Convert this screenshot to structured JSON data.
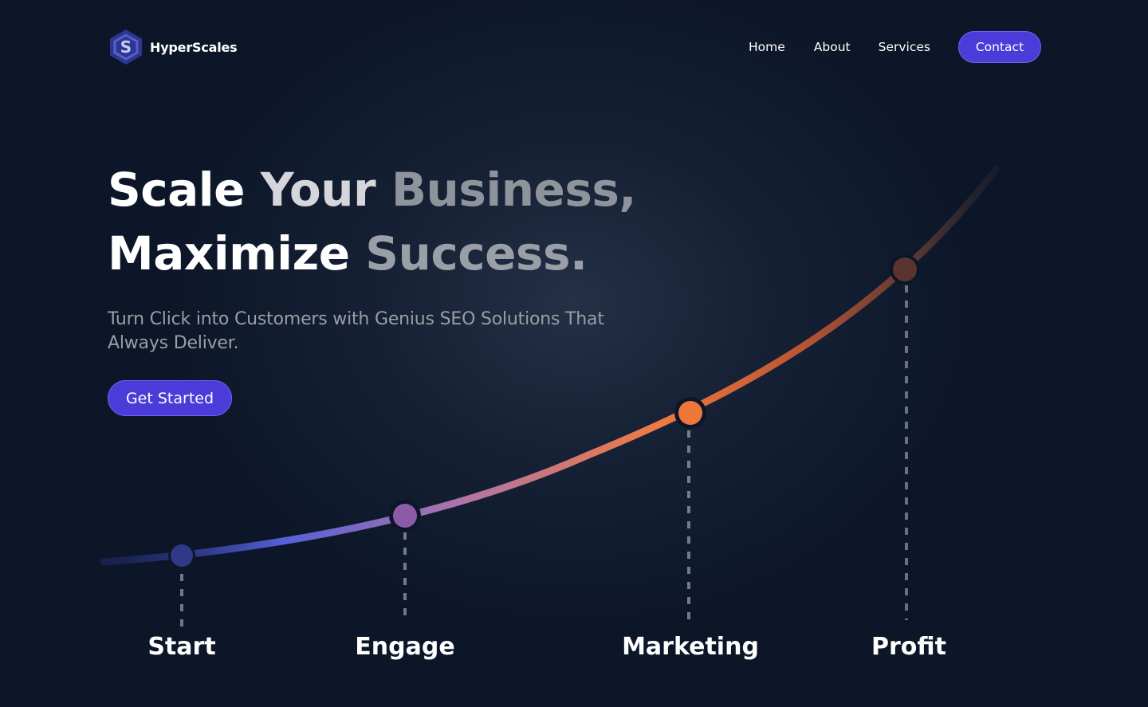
{
  "brand": {
    "name": "HyperScales",
    "logo_icon": "hex-s-logo-icon",
    "logo_letter": "S",
    "colors": {
      "logo_dark": "#2e3690",
      "logo_light": "#5560c8"
    }
  },
  "nav": {
    "items": [
      {
        "label": "Home"
      },
      {
        "label": "About"
      },
      {
        "label": "Services"
      }
    ],
    "contact_label": "Contact"
  },
  "hero": {
    "headline_line1": [
      "Scale",
      "Your",
      "Business,"
    ],
    "headline_line2": [
      "Maximize",
      "Success."
    ],
    "subtitle": "Turn Click into Customers with Genius SEO Solutions That Always Deliver.",
    "cta_label": "Get Started"
  },
  "growth_path": {
    "stages": [
      {
        "label": "Start",
        "color": "#2e3a86"
      },
      {
        "label": "Engage",
        "color": "#8a5ca8"
      },
      {
        "label": "Marketing",
        "color": "#f0773a"
      },
      {
        "label": "Profit",
        "color": "#5a3530"
      }
    ],
    "gradient": [
      "#2b3590",
      "#5560d8",
      "#b075a8",
      "#f07a40",
      "#b85432",
      "#5e3a34",
      "#2a2a36"
    ]
  },
  "theme": {
    "background": "#0c1628",
    "accent": "#4b3bd8"
  }
}
